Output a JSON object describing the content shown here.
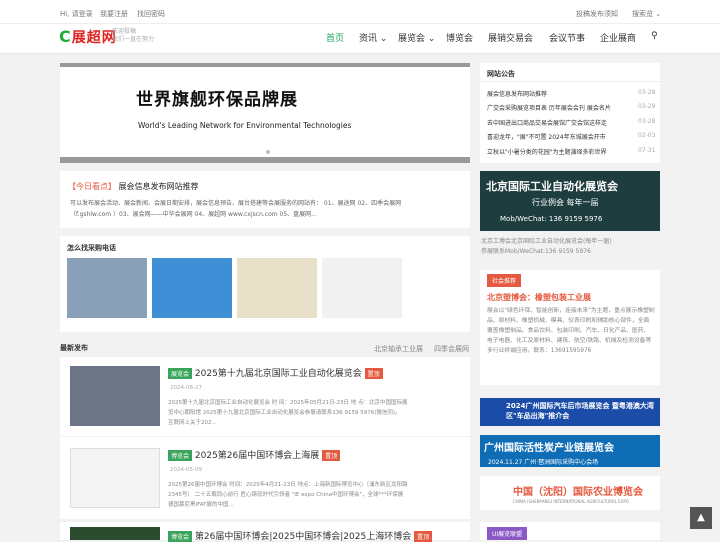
{
  "topbar": {
    "login": "Hi, 请登录",
    "register": "我要注册",
    "forgot": "找回密码",
    "cta": "投稿发布须知",
    "search": "搜索览 ⌄"
  },
  "header": {
    "logo": "展超网",
    "logo_c": "C",
    "tagline1": "欢迎投稿",
    "tagline2": "我们一直在努力"
  },
  "nav": [
    "首页",
    "资讯 ⌄",
    "展览会 ⌄",
    "博览会",
    "展销交易会",
    "会议节事",
    "企业展商"
  ],
  "banner": {
    "title": "世界旗舰环保品牌展",
    "subtitle": "World's Leading Network for Environmental Technologies"
  },
  "notice": {
    "tag": "【今日看点】",
    "title": "展会信息发布网站推荐",
    "body1": "可以发布展会活动、展会新闻、会展日期安排，展会信息预告、展台搭建等会展服务的网站有：  01、展途网  02、四季会展网",
    "body2": "（f.gshlw.com ）03、展会网——中华会展网  04、展超网 www.cxjscn.com 05、盘展网..."
  },
  "findphone": {
    "title": "怎么找采购电话"
  },
  "latest": {
    "title": "最新发布",
    "tab1": "北京轴承工业展",
    "tab2": "四季会展网"
  },
  "posts": [
    {
      "cat": "展览会",
      "title": "2025第十九届北京国际工业自动化展览会",
      "hot": "置顶",
      "date": "2024-08-27",
      "d1": "2025第十九届北京国际工业自动化展览会 时 间：2025年05月21日-23日 地 点：北京中国国际展",
      "d2": "览中心朝阳馆 2025第十九届北京国际工业自动化展览会参展请联系136 9159 5976(微信同)。",
      "d3": "互联网上关于202..."
    },
    {
      "cat": "博览会",
      "title": "2025第26届中国环博会上海展",
      "hot": "置顶",
      "date": "2024-05-09",
      "d1": "2025第26届中国环博会 时间：2025年4月21-23日 地点：上海新国际博览中心（浦东新区龙阳路",
      "d2": "2345号） 二十五载同心前行  匠心铸就时代引领者 \"IE expo China中国环博会\"，全球***环保展",
      "d3": "德国慕尼黑IFAT展的中国..."
    },
    {
      "cat": "博览会",
      "title": "第26届中国环博会|2025中国环博会|2025上海环博会",
      "hot": "置顶"
    }
  ],
  "side": {
    "notice_title": "网站公告",
    "notices": [
      {
        "t": "展会信息发布网站推荐",
        "d": "03-28"
      },
      {
        "t": "广交会采购展览项目表 历年展会会刊 展会名片",
        "d": "03-29"
      },
      {
        "t": "去中国进出口商品交易会展馆广交会馆这样走",
        "d": "03-28"
      },
      {
        "t": "喜迎龙年，\"展\"不可置 2024年东城展会开市",
        "d": "02-03"
      },
      {
        "t": "立秋以\"小暑分类的花园\"为主题演绎多彩世界",
        "d": "07-31"
      }
    ],
    "ad1_title": "北京国际工业自动化展览会",
    "ad1_sub": "行业例会  每年一届",
    "ad1_phone": "Mob/WeChat: 136 9159 5976",
    "ad1_cap1": "北京工博会北京国际工业自动化展览会(每年一届)",
    "ad1_cap2": "参展联系Mob/WeChat:136 9159 5976",
    "rec_tag": "社会推荐",
    "rec_title": "北京塑博会：橡塑包装工业展",
    "rec_body": "展会以\"绿色环保、智能创新，连接未来\"为主题，重点展示橡塑制品、原材料、橡塑机械、模具、仪表印刷和辅助核心部件，全面覆盖橡塑制品、食品饮料、包装印刷、汽车、日化产品、医药、电子电器、化工及原材料、建筑、航空/铁路、机械及检测设备等多行业终端应用。联系：13691595976",
    "ad2": "2024广州国际汽车后市场展览会 暨粤港澳大湾区\"车品出海\"推介会",
    "ad3": "广州国际活性炭产业链展览会",
    "ad3_sub": "2024.11.27   广州·琶洲国际采购中心会场",
    "ad4": "中国（沈阳）国际农业博览会",
    "ad4_sub": "CHINA (SHENYANG) INTERNATIONAL AGRICULTURAL EXPO",
    "union": "UI展览联盟"
  }
}
